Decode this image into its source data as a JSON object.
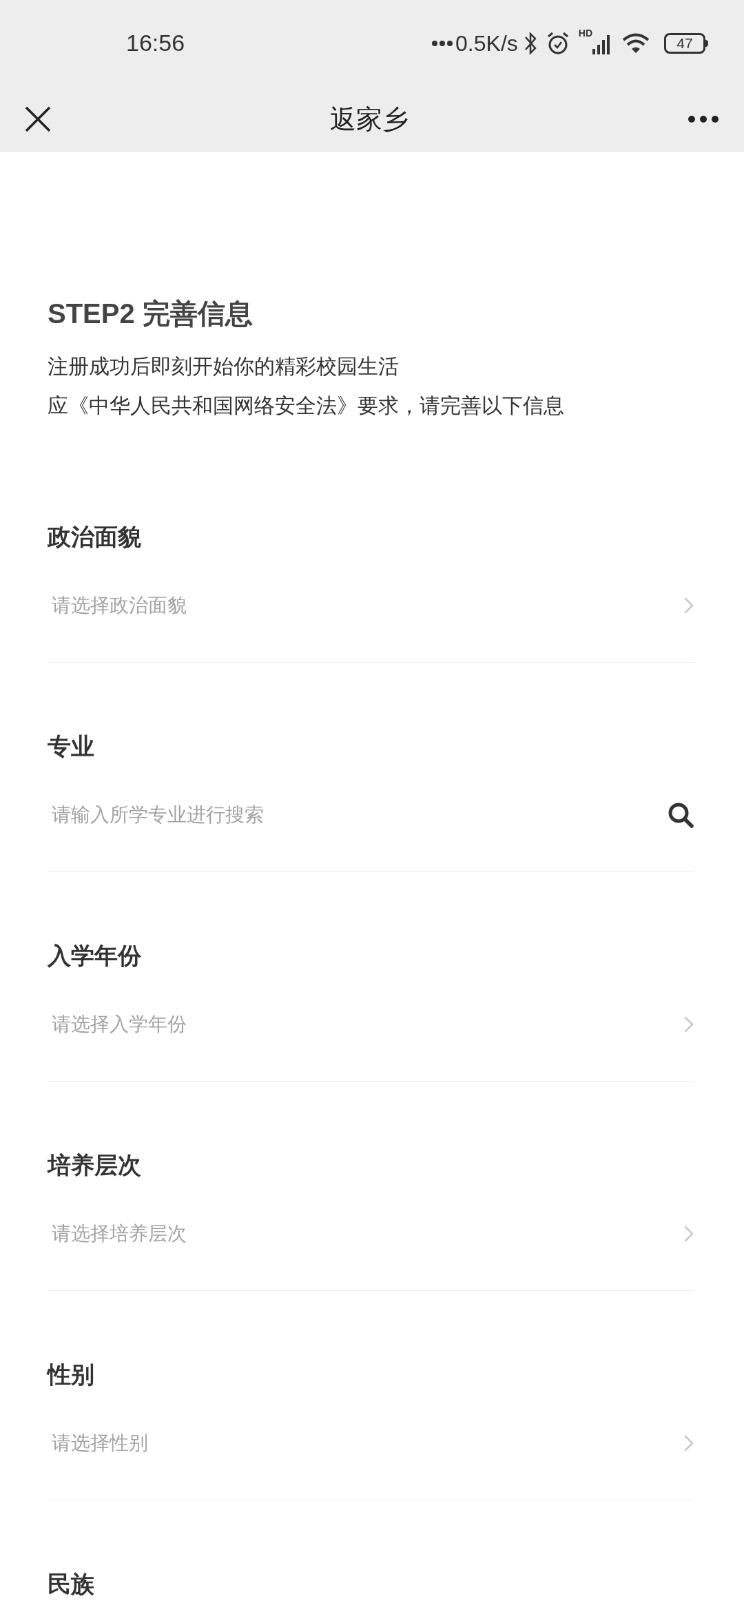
{
  "status_bar": {
    "time": "16:56",
    "net_speed": "0.5K/s",
    "hd_label": "HD",
    "battery": "47"
  },
  "nav_bar": {
    "title": "返家乡"
  },
  "header": {
    "title": "STEP2 完善信息",
    "lines": [
      "注册成功后即刻开始你的精彩校园生活",
      "应《中华人民共和国网络安全法》要求，请完善以下信息"
    ]
  },
  "fields": [
    {
      "label": "政治面貌",
      "placeholder": "请选择政治面貌",
      "kind": "select"
    },
    {
      "label": "专业",
      "placeholder": "请输入所学专业进行搜索",
      "kind": "search"
    },
    {
      "label": "入学年份",
      "placeholder": "请选择入学年份",
      "kind": "select"
    },
    {
      "label": "培养层次",
      "placeholder": "请选择培养层次",
      "kind": "select"
    },
    {
      "label": "性别",
      "placeholder": "请选择性别",
      "kind": "select"
    },
    {
      "label": "民族"
    }
  ]
}
